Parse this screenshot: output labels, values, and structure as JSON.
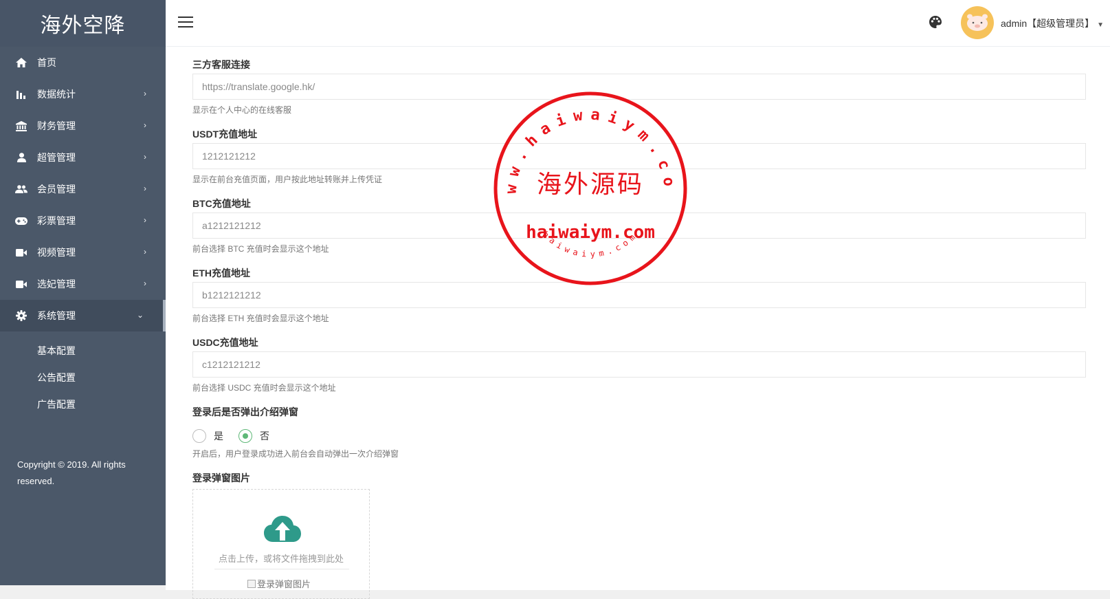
{
  "brand": "海外空降",
  "sidebar": {
    "items": [
      {
        "label": "首页",
        "icon": "home-icon",
        "has_arrow": false
      },
      {
        "label": "数据统计",
        "icon": "bar-chart-icon",
        "has_arrow": true
      },
      {
        "label": "财务管理",
        "icon": "bank-icon",
        "has_arrow": true
      },
      {
        "label": "超管管理",
        "icon": "user-icon",
        "has_arrow": true
      },
      {
        "label": "会员管理",
        "icon": "users-icon",
        "has_arrow": true
      },
      {
        "label": "彩票管理",
        "icon": "gamepad-icon",
        "has_arrow": true
      },
      {
        "label": "视频管理",
        "icon": "video-camera-icon",
        "has_arrow": true
      },
      {
        "label": "选妃管理",
        "icon": "video-camera-icon",
        "has_arrow": true
      },
      {
        "label": "系统管理",
        "icon": "gear-icon",
        "has_arrow": true,
        "active": true
      }
    ],
    "submenu": [
      "基本配置",
      "公告配置",
      "广告配置"
    ],
    "copyright": "Copyright © 2019. All rights reserved."
  },
  "topbar": {
    "user": "admin【超级管理员】"
  },
  "form": {
    "fields": [
      {
        "label": "三方客服连接",
        "value": "https://translate.google.hk/",
        "help": "显示在个人中心的在线客服"
      },
      {
        "label": "USDT充值地址",
        "value": "1212121212",
        "help": "显示在前台充值页面，用户按此地址转账并上传凭证"
      },
      {
        "label": "BTC充值地址",
        "value": "a1212121212",
        "help": "前台选择 BTC 充值时会显示这个地址"
      },
      {
        "label": "ETH充值地址",
        "value": "b1212121212",
        "help": "前台选择 ETH 充值时会显示这个地址"
      },
      {
        "label": "USDC充值地址",
        "value": "c1212121212",
        "help": "前台选择 USDC 充值时会显示这个地址"
      }
    ],
    "popup": {
      "label": "登录后是否弹出介绍弹窗",
      "options": [
        "是",
        "否"
      ],
      "selected": "否",
      "help": "开启后，用户登录成功进入前台会自动弹出一次介绍弹窗"
    },
    "image": {
      "label": "登录弹窗图片",
      "upload_text": "点击上传，或将文件拖拽到此处",
      "preview_alt": "登录弹窗图片"
    }
  },
  "watermark": {
    "center_text": "海外源码",
    "url": "haiwaiym.com",
    "arc_top": "www.haiwaiym.com",
    "arc_bottom": "haiwaiym.com",
    "color": "#e8141b"
  },
  "colors": {
    "sidebar_bg": "#4b5869",
    "accent_green": "#5fb878",
    "upload_icon": "#2e9a8a"
  }
}
